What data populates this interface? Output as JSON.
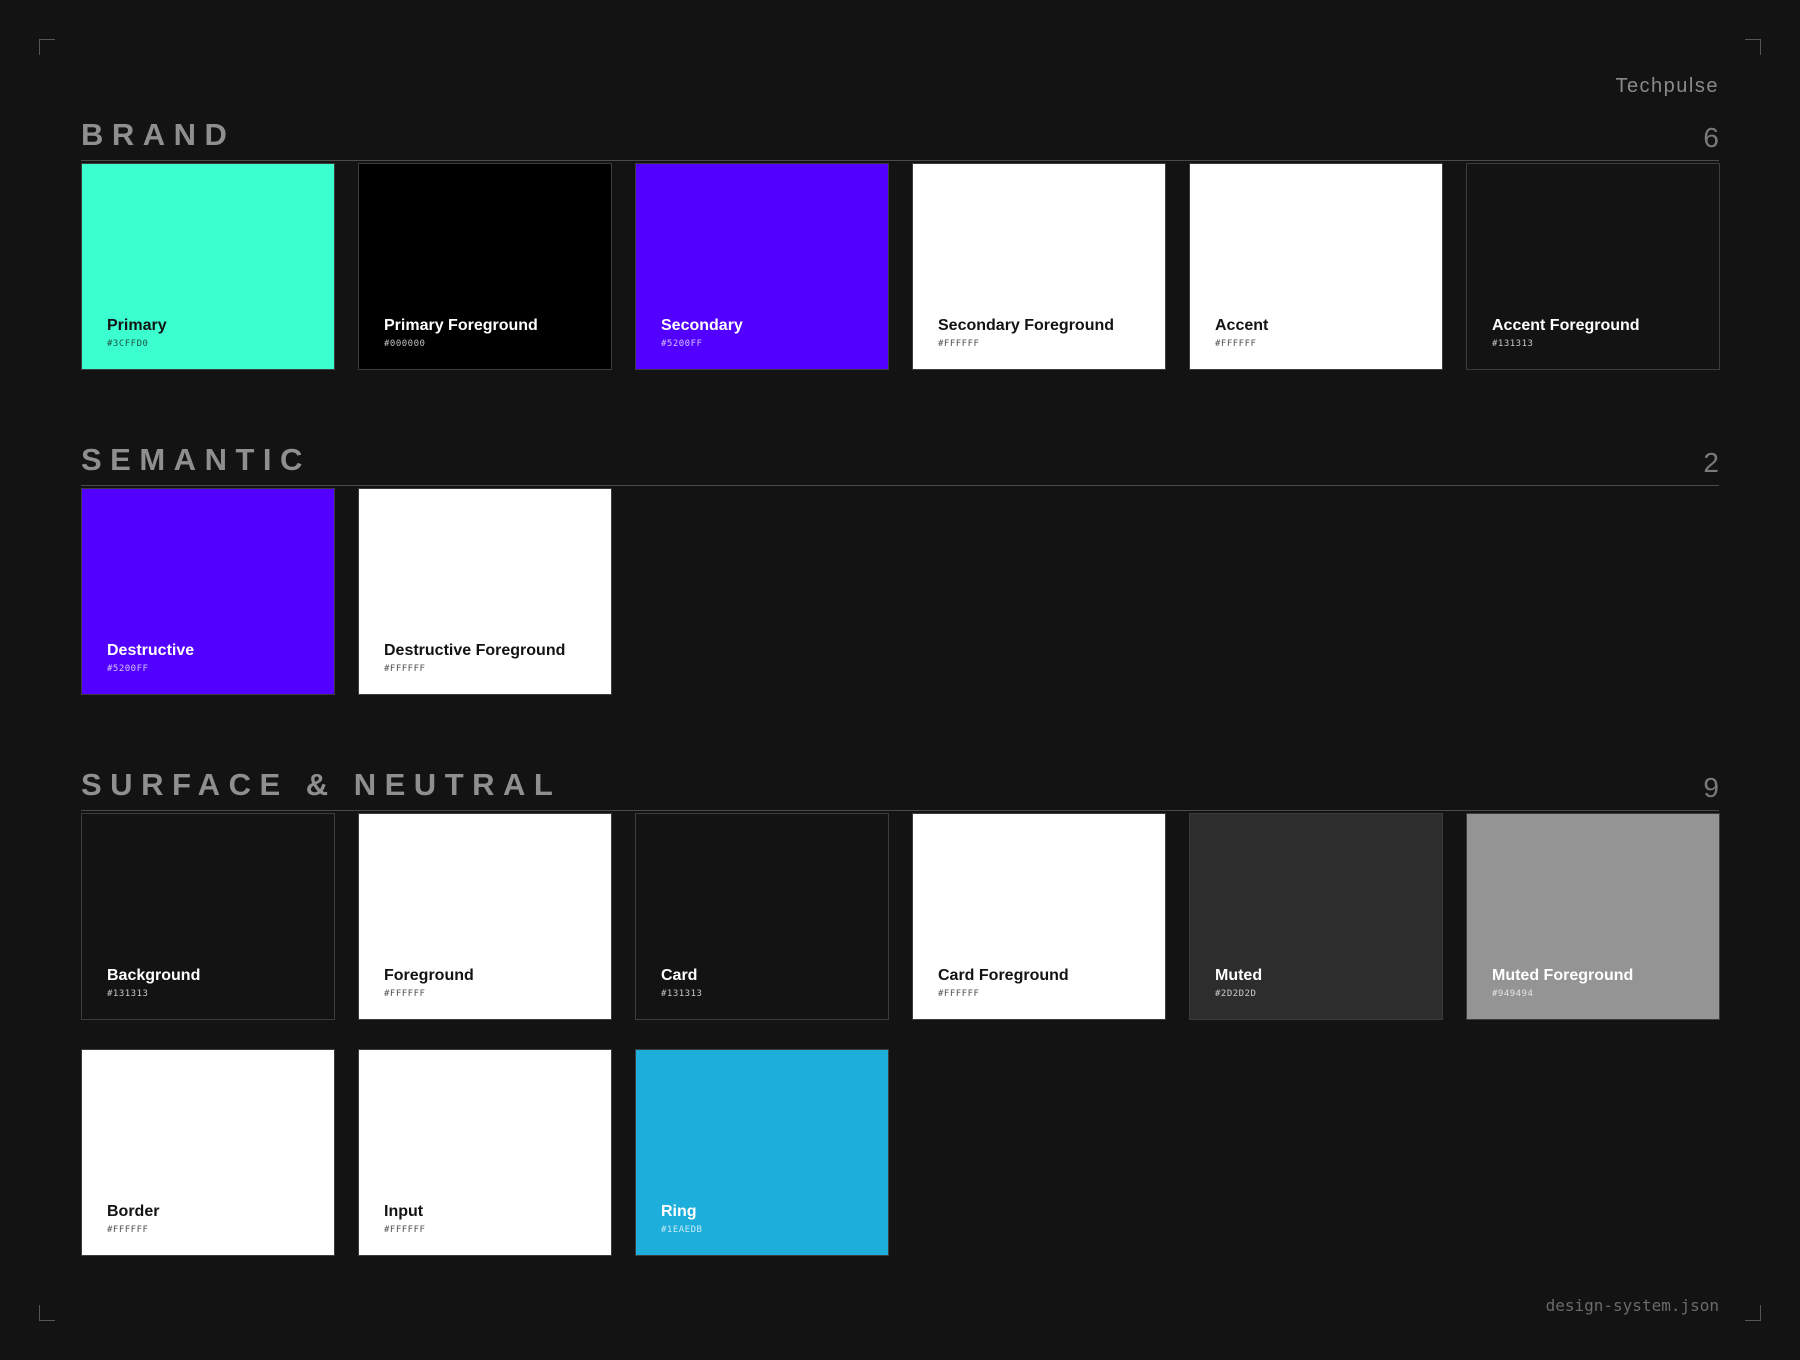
{
  "header": {
    "brand": "Techpulse"
  },
  "footer": {
    "file": "design-system.json"
  },
  "sections": [
    {
      "title": "BRAND",
      "count": "6",
      "swatches": [
        {
          "label": "Primary",
          "hex": "#3CFFD0",
          "text_color": "#131313"
        },
        {
          "label": "Primary Foreground",
          "hex": "#000000",
          "text_color": "#FFFFFF"
        },
        {
          "label": "Secondary",
          "hex": "#5200FF",
          "text_color": "#FFFFFF"
        },
        {
          "label": "Secondary Foreground",
          "hex": "#FFFFFF",
          "text_color": "#131313"
        },
        {
          "label": "Accent",
          "hex": "#FFFFFF",
          "text_color": "#131313"
        },
        {
          "label": "Accent Foreground",
          "hex": "#131313",
          "text_color": "#FFFFFF"
        }
      ]
    },
    {
      "title": "SEMANTIC",
      "count": "2",
      "swatches": [
        {
          "label": "Destructive",
          "hex": "#5200FF",
          "text_color": "#FFFFFF"
        },
        {
          "label": "Destructive Foreground",
          "hex": "#FFFFFF",
          "text_color": "#131313"
        }
      ]
    },
    {
      "title": "SURFACE & NEUTRAL",
      "count": "9",
      "swatches": [
        {
          "label": "Background",
          "hex": "#131313",
          "text_color": "#FFFFFF"
        },
        {
          "label": "Foreground",
          "hex": "#FFFFFF",
          "text_color": "#131313"
        },
        {
          "label": "Card",
          "hex": "#131313",
          "text_color": "#FFFFFF"
        },
        {
          "label": "Card Foreground",
          "hex": "#FFFFFF",
          "text_color": "#131313"
        },
        {
          "label": "Muted",
          "hex": "#2D2D2D",
          "text_color": "#FFFFFF"
        },
        {
          "label": "Muted Foreground",
          "hex": "#949494",
          "text_color": "#FFFFFF"
        },
        {
          "label": "Border",
          "hex": "#FFFFFF",
          "text_color": "#131313"
        },
        {
          "label": "Input",
          "hex": "#FFFFFF",
          "text_color": "#131313"
        },
        {
          "label": "Ring",
          "hex": "#1EAEDB",
          "text_color": "#FFFFFF"
        }
      ]
    }
  ]
}
